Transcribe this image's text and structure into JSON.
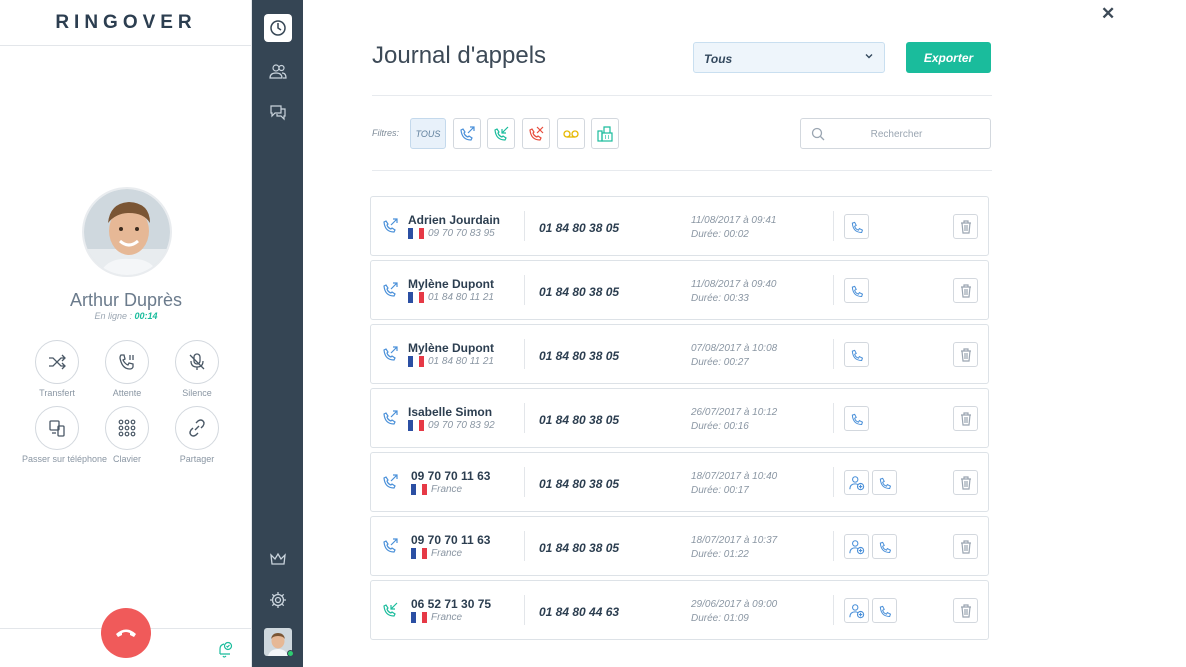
{
  "brand": {
    "logo": "RINGOVER"
  },
  "caller": {
    "name": "Arthur Duprès",
    "status_label": "En ligne :",
    "duration": "00:14"
  },
  "actions": [
    {
      "label": "Transfert",
      "icon": "shuffle-icon"
    },
    {
      "label": "Attente",
      "icon": "phone-pause-icon"
    },
    {
      "label": "Silence",
      "icon": "mic-off-icon"
    },
    {
      "label": "Passer sur téléphone",
      "icon": "device-switch-icon"
    },
    {
      "label": "Clavier",
      "icon": "keypad-icon"
    },
    {
      "label": "Partager",
      "icon": "link-icon"
    }
  ],
  "nav": {
    "items": [
      "clock-icon",
      "contacts-icon",
      "chat-icon",
      "crown-icon",
      "settings-icon"
    ]
  },
  "header": {
    "title": "Journal d'appels",
    "select_value": "Tous",
    "export_label": "Exporter"
  },
  "filters": {
    "label": "Filtres:",
    "all_label": "TOUS",
    "search_placeholder": "Rechercher"
  },
  "colors": {
    "accent": "#1abc9c",
    "nav_bg": "#354554",
    "hangup": "#f05a5a",
    "outgoing": "#4a90d9",
    "incoming": "#1abc9c",
    "missed": "#e74c3c",
    "voicemail": "#f1c40f"
  },
  "calls": [
    {
      "direction": "outgoing",
      "name": "Adrien Jourdain",
      "sub": "09 70 70 83 95",
      "to": "01 84 80 38 05",
      "date": "11/08/2017 à 09:41",
      "duration": "Durée: 00:02",
      "add_contact": false
    },
    {
      "direction": "outgoing",
      "name": "Mylène Dupont",
      "sub": "01 84 80 11 21",
      "to": "01 84 80 38 05",
      "date": "11/08/2017 à 09:40",
      "duration": "Durée: 00:33",
      "add_contact": false
    },
    {
      "direction": "outgoing",
      "name": "Mylène Dupont",
      "sub": "01 84 80 11 21",
      "to": "01 84 80 38 05",
      "date": "07/08/2017 à 10:08",
      "duration": "Durée: 00:27",
      "add_contact": false
    },
    {
      "direction": "outgoing",
      "name": "Isabelle Simon",
      "sub": "09 70 70 83 92",
      "to": "01 84 80 38 05",
      "date": "26/07/2017 à 10:12",
      "duration": "Durée: 00:16",
      "add_contact": false
    },
    {
      "direction": "outgoing",
      "name": "09 70 70 11 63",
      "sub": "France",
      "to": "01 84 80 38 05",
      "date": "18/07/2017 à 10:40",
      "duration": "Durée: 00:17",
      "add_contact": true
    },
    {
      "direction": "outgoing",
      "name": "09 70 70 11 63",
      "sub": "France",
      "to": "01 84 80 38 05",
      "date": "18/07/2017 à 10:37",
      "duration": "Durée: 01:22",
      "add_contact": true
    },
    {
      "direction": "incoming",
      "name": "06 52 71 30 75",
      "sub": "France",
      "to": "01 84 80 44 63",
      "date": "29/06/2017 à 09:00",
      "duration": "Durée: 01:09",
      "add_contact": true
    }
  ]
}
